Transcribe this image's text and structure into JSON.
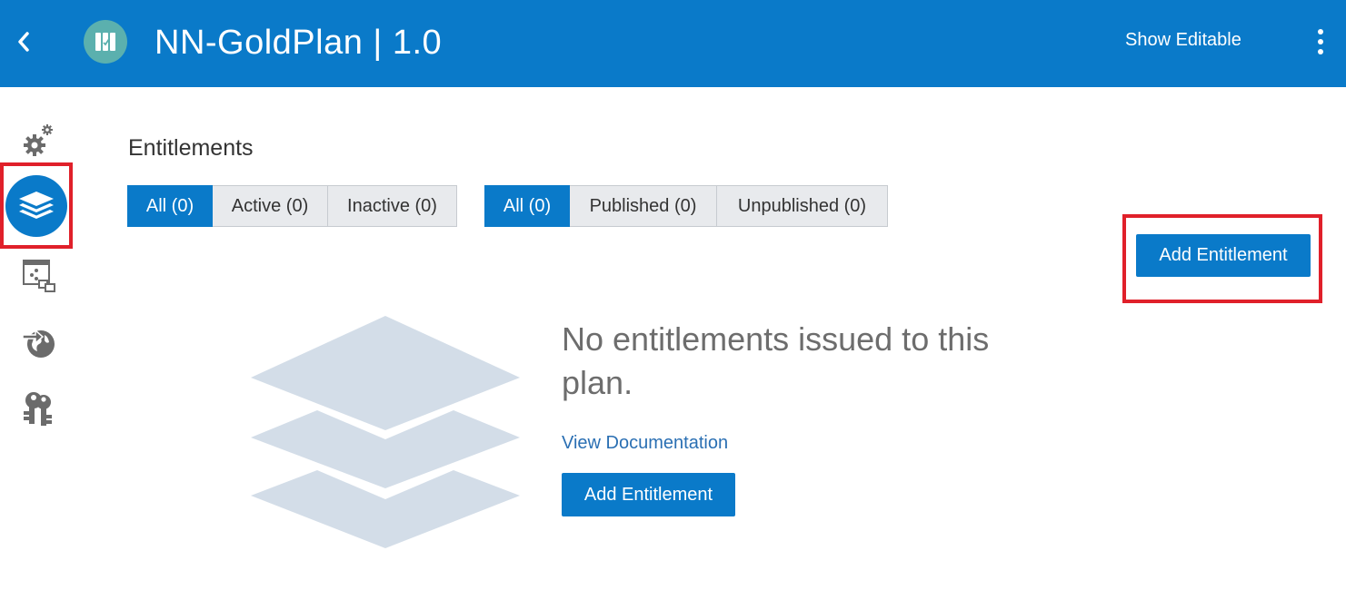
{
  "header": {
    "title": "NN-GoldPlan | 1.0",
    "show_editable_label": "Show Editable",
    "background_color": "#0a7ac9",
    "icons": [
      "chevron-left-icon",
      "plan-logo-icon",
      "kebab-menu-icon"
    ]
  },
  "sidebar": {
    "items": [
      {
        "name": "settings",
        "icon": "gears-icon",
        "active": false
      },
      {
        "name": "entitlements",
        "icon": "layers-icon",
        "active": true
      },
      {
        "name": "services",
        "icon": "service-link-icon",
        "active": false
      },
      {
        "name": "global-deploy",
        "icon": "globe-arrow-icon",
        "active": false
      },
      {
        "name": "keys",
        "icon": "keys-icon",
        "active": false
      }
    ]
  },
  "main": {
    "section_title": "Entitlements",
    "status_filter": [
      {
        "label": "All (0)",
        "active": true
      },
      {
        "label": "Active (0)",
        "active": false
      },
      {
        "label": "Inactive (0)",
        "active": false
      }
    ],
    "publish_filter": [
      {
        "label": "All (0)",
        "active": true
      },
      {
        "label": "Published (0)",
        "active": false
      },
      {
        "label": "Unpublished (0)",
        "active": false
      }
    ],
    "add_button_label": "Add Entitlement",
    "empty_state": {
      "message": "No entitlements issued to this plan.",
      "doc_link": "View Documentation",
      "button_label": "Add Entitlement",
      "illustration_icon": "stacked-layers-icon"
    }
  },
  "colors": {
    "accent": "#0a7ac9",
    "highlight": "#e0202a",
    "segment_bg": "#e8eaed",
    "illustration": "#d3dde8"
  }
}
